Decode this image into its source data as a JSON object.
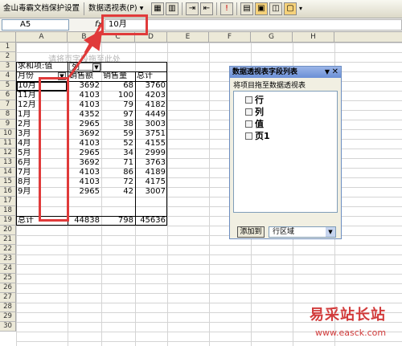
{
  "toolbar": {
    "protect_doc": "金山毒霸文档保护设置",
    "pivot_menu": "数据透视表(P) ▾"
  },
  "formula_bar": {
    "name_box": "A5",
    "fx": "fx",
    "content": "10月"
  },
  "columns": [
    "A",
    "B",
    "C",
    "D",
    "E",
    "F",
    "G",
    "H"
  ],
  "rows": [
    "1",
    "2",
    "3",
    "4",
    "5",
    "6",
    "7",
    "8",
    "9",
    "10",
    "11",
    "12",
    "13",
    "14",
    "15",
    "16",
    "17",
    "18",
    "19",
    "20",
    "21",
    "22",
    "23",
    "24",
    "25",
    "26",
    "27",
    "28",
    "29",
    "30"
  ],
  "pivot": {
    "page_hint": "请将页字段拖至此处",
    "sum_label": "求和项:值",
    "col_field": "列",
    "headers": [
      "月份",
      "销售额",
      "销售量",
      "总计"
    ],
    "rows": [
      [
        "10月",
        "3692",
        "68",
        "3760"
      ],
      [
        "11月",
        "4103",
        "100",
        "4203"
      ],
      [
        "12月",
        "4103",
        "79",
        "4182"
      ],
      [
        "1月",
        "4352",
        "97",
        "4449"
      ],
      [
        "2月",
        "2965",
        "38",
        "3003"
      ],
      [
        "3月",
        "3692",
        "59",
        "3751"
      ],
      [
        "4月",
        "4103",
        "52",
        "4155"
      ],
      [
        "5月",
        "2965",
        "34",
        "2999"
      ],
      [
        "6月",
        "3692",
        "71",
        "3763"
      ],
      [
        "7月",
        "4103",
        "86",
        "4189"
      ],
      [
        "8月",
        "4103",
        "72",
        "4175"
      ],
      [
        "9月",
        "2965",
        "42",
        "3007"
      ]
    ],
    "total": [
      "总计",
      "44838",
      "798",
      "45636"
    ]
  },
  "panel": {
    "title": "数据透视表字段列表",
    "description": "将项目拖至数据透视表",
    "fields": [
      "行",
      "列",
      "值",
      "页1"
    ],
    "add_button": "添加到",
    "area_select": "行区域"
  },
  "watermark": {
    "brand": "易采站长站",
    "url": "www.easck.com"
  }
}
